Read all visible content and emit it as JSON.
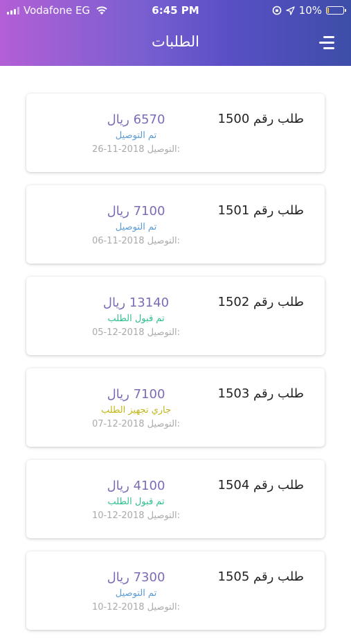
{
  "status_bar": {
    "carrier": "Vodafone EG",
    "time": "6:45 PM",
    "battery": "10%",
    "battery_level": 0.1
  },
  "header": {
    "title": "الطلبات"
  },
  "orders": [
    {
      "label": "طلب رقم 1500",
      "amount": "6570 ريال",
      "status": "تم التوصيل",
      "status_color": "#5a9bd5",
      "delivery_label": "التوصيل:",
      "delivery_date": "26-11-2018"
    },
    {
      "label": "طلب رقم 1501",
      "amount": "7100 ريال",
      "status": "تم التوصيل",
      "status_color": "#5a9bd5",
      "delivery_label": "التوصيل:",
      "delivery_date": "06-11-2018"
    },
    {
      "label": "طلب رقم 1502",
      "amount": "13140 ريال",
      "status": "تم قبول الطلب",
      "status_color": "#2ebf8f",
      "delivery_label": "التوصيل:",
      "delivery_date": "05-12-2018"
    },
    {
      "label": "طلب رقم 1503",
      "amount": "7100 ريال",
      "status": "جاري تجهيز الطلب",
      "status_color": "#c2b514",
      "delivery_label": "التوصيل:",
      "delivery_date": "07-12-2018"
    },
    {
      "label": "طلب رقم 1504",
      "amount": "4100 ريال",
      "status": "تم قبول الطلب",
      "status_color": "#2ebf8f",
      "delivery_label": "التوصيل:",
      "delivery_date": "10-12-2018"
    },
    {
      "label": "طلب رقم 1505",
      "amount": "7300 ريال",
      "status": "تم التوصيل",
      "status_color": "#5a9bd5",
      "delivery_label": "التوصيل:",
      "delivery_date": "10-12-2018"
    }
  ],
  "icons": {
    "menu": "menu-icon",
    "wifi": "wifi-icon",
    "signal": "signal-icon",
    "location": "location-arrow-icon",
    "orientation_lock": "orientation-lock-icon",
    "battery": "battery-icon"
  }
}
